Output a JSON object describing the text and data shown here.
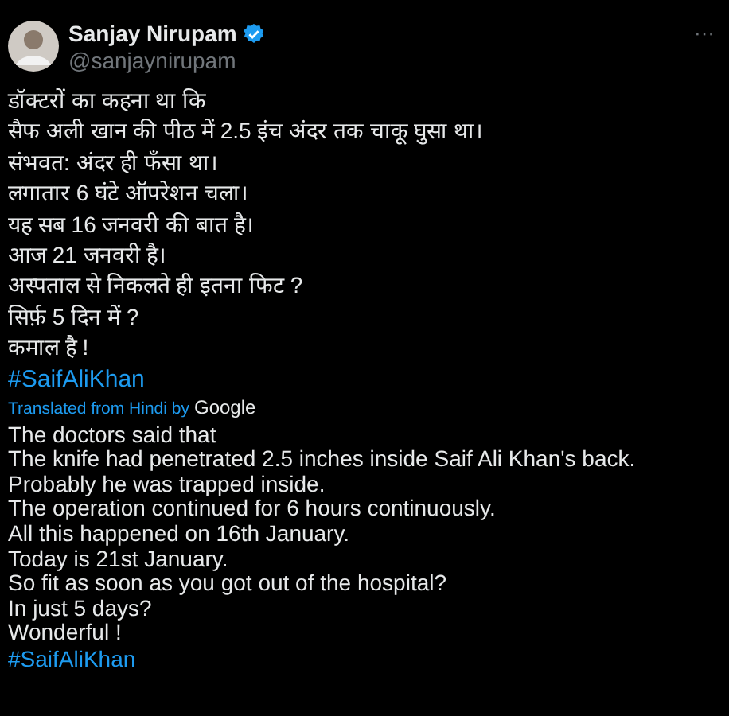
{
  "author": {
    "name": "Sanjay Nirupam",
    "verified": true,
    "handle": "@sanjaynirupam"
  },
  "more_button": "···",
  "tweet": {
    "text": "डॉक्टरों का कहना था कि\nसैफ अली खान की पीठ में 2.5 इंच अंदर तक चाकू घुसा था।\nसंभवत: अंदर ही फँसा था।\nलगातार 6 घंटे ऑपरेशन चला।\nयह सब 16 जनवरी की बात है।\nआज 21 जनवरी है।\nअस्पताल से निकलते ही इतना फिट ?\nसिर्फ़ 5 दिन में ?\nकमाल है !",
    "hashtag": "#SaifAliKhan"
  },
  "translation": {
    "label": "Translated from Hindi by",
    "provider": "Google",
    "text": "The doctors said that\nThe knife had penetrated 2.5 inches inside Saif Ali Khan's back.\nProbably he was trapped inside.\nThe operation continued for 6 hours continuously.\nAll this happened on 16th January.\nToday is 21st January.\nSo fit as soon as you got out of the hospital?\nIn just 5 days?\nWonderful !",
    "hashtag": "#SaifAliKhan"
  }
}
